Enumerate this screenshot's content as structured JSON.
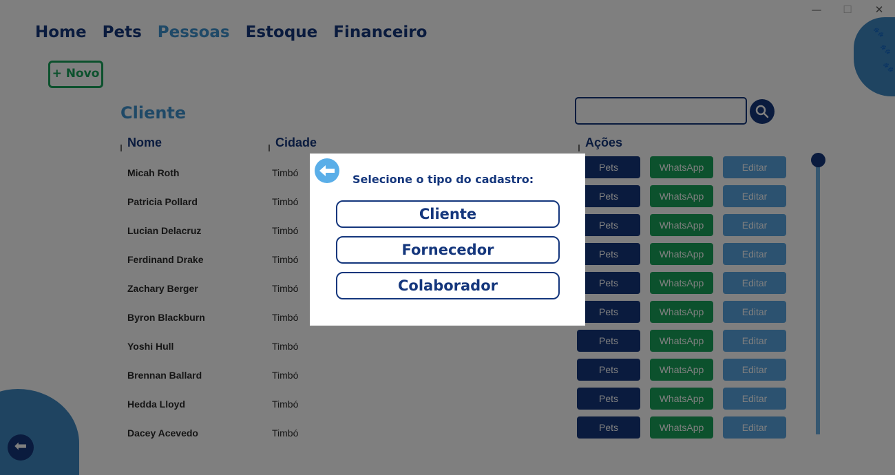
{
  "window": {
    "minimize": "—",
    "maximize": "☐",
    "close": "✕"
  },
  "nav": [
    {
      "label": "Home",
      "active": false
    },
    {
      "label": "Pets",
      "active": false
    },
    {
      "label": "Pessoas",
      "active": true
    },
    {
      "label": "Estoque",
      "active": false
    },
    {
      "label": "Financeiro",
      "active": false
    }
  ],
  "new_button": "+ Novo",
  "section_title": "Cliente",
  "search": {
    "value": "",
    "placeholder": "",
    "icon": "search-icon"
  },
  "table": {
    "headers": {
      "name": "Nome",
      "city": "Cidade",
      "actions": "Ações"
    },
    "action_labels": {
      "pets": "Pets",
      "whatsapp": "WhatsApp",
      "edit": "Editar"
    },
    "rows": [
      {
        "name": "Micah Roth",
        "city": "Timbó"
      },
      {
        "name": "Patricia Pollard",
        "city": "Timbó"
      },
      {
        "name": "Lucian Delacruz",
        "city": "Timbó"
      },
      {
        "name": "Ferdinand Drake",
        "city": "Timbó"
      },
      {
        "name": "Zachary Berger",
        "city": "Timbó"
      },
      {
        "name": "Byron Blackburn",
        "city": "Timbó"
      },
      {
        "name": "Yoshi Hull",
        "city": "Timbó"
      },
      {
        "name": "Brennan Ballard",
        "city": "Timbó"
      },
      {
        "name": "Hedda Lloyd",
        "city": "Timbó"
      },
      {
        "name": "Dacey Acevedo",
        "city": "Timbó"
      }
    ]
  },
  "modal": {
    "title": "Selecione o tipo do cadastro:",
    "options": [
      "Cliente",
      "Fornecedor",
      "Colaborador"
    ],
    "back_icon": "arrow-left-icon"
  },
  "colors": {
    "navy": "#14367c",
    "accent_blue": "#3f93cf",
    "green": "#18a35a",
    "light_blue": "#58a5e0"
  }
}
